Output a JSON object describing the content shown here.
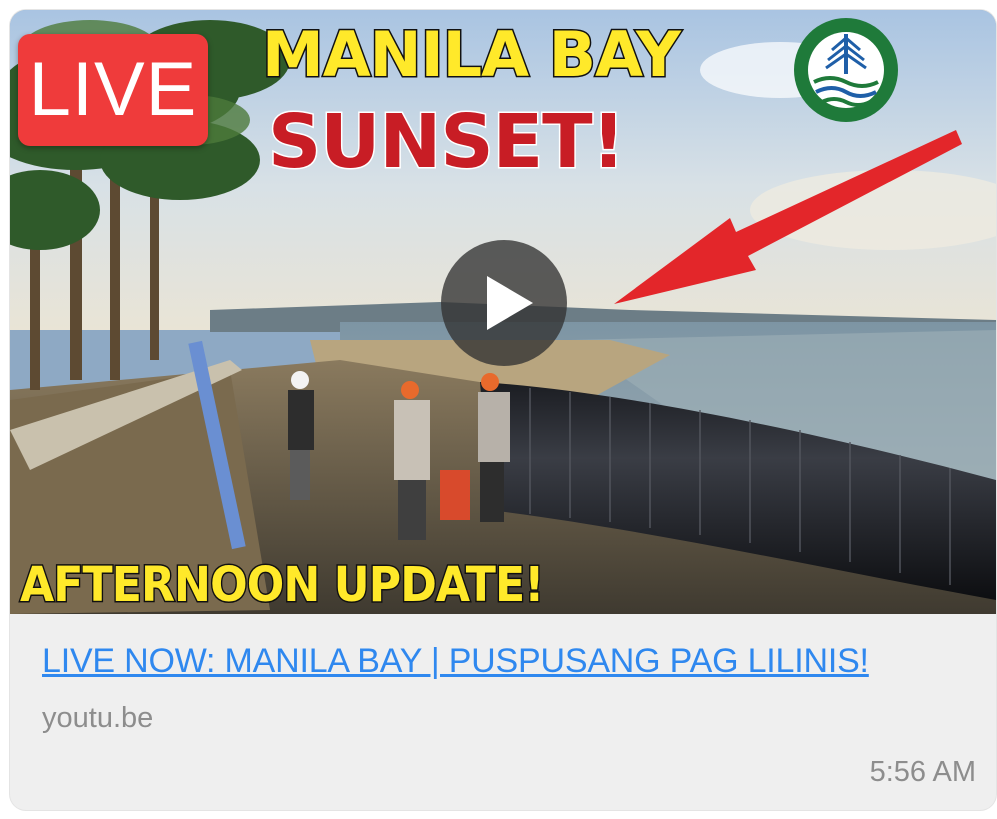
{
  "message": {
    "thumbnail": {
      "live_badge": "LIVE",
      "headline_top": "MANILA BAY",
      "headline_main": "SUNSET!",
      "headline_bottom": "AFTERNOON UPDATE!",
      "icons": [
        "play-icon",
        "red-arrow-icon",
        "agency-seal-icon"
      ]
    },
    "link_title": "LIVE NOW: MANILA BAY | PUSPUSANG PAG LILINIS!",
    "domain": "youtu.be",
    "timestamp": "5:56 AM"
  },
  "colors": {
    "link": "#2f88ef",
    "meta_text": "#8d8d8d",
    "card_bg": "#efefef",
    "live_badge": "#ef3b3b",
    "headline_yellow": "#ffe92a",
    "headline_red": "#c81d25"
  }
}
